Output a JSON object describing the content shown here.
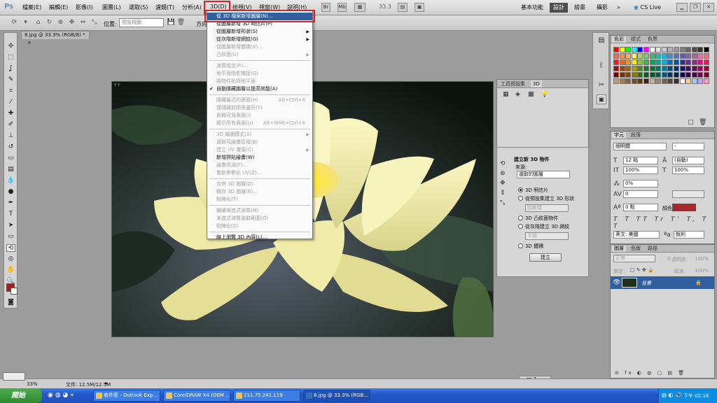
{
  "app": {
    "logo": "Ps",
    "menus": [
      "檔案(E)",
      "編輯(E)",
      "影像(I)",
      "圖層(L)",
      "選取(S)",
      "濾鏡(T)",
      "分析(A)",
      "3D(D)",
      "檢視(V)",
      "視窗(W)",
      "說明(H)"
    ],
    "zoom": "33.3",
    "workspaces": [
      "基本功能",
      "設計",
      "繪畫",
      "攝影"
    ],
    "cs_live": "CS Live"
  },
  "options": {
    "position_label": "位置:",
    "position_value": "預設視圖",
    "direction_label": "方向"
  },
  "document": {
    "tab_title": "8.jpg @ 33.3% (RGB/8) *",
    "status_zoom": "33%",
    "status_doc": "文件: 12.5M/12.5M"
  },
  "menu3d": {
    "items": [
      {
        "label": "從 3D 檔案新增圖層(N)...",
        "state": "highlight"
      },
      {
        "label": "從圖層新增 3D 明信片(P)",
        "state": "enabled"
      },
      {
        "label": "從圖層新增形狀(S)",
        "state": "enabled",
        "arrow": true
      },
      {
        "label": "從灰階新增網紋(G)",
        "state": "enabled",
        "arrow": true
      },
      {
        "label": "從圖層新增體積(V)...",
        "state": "disabled"
      },
      {
        "label": "凸紋面(U)",
        "state": "disabled",
        "arrow": true
      },
      {
        "sep": true
      },
      {
        "label": "演算設定(R)...",
        "state": "disabled"
      },
      {
        "label": "地平面陰影捕捉(G)",
        "state": "disabled"
      },
      {
        "label": "將物件貼齊地平面",
        "state": "disabled"
      },
      {
        "label": "自動隱藏圖層以提高效能(A)",
        "state": "enabled",
        "check": true
      },
      {
        "sep": true
      },
      {
        "label": "隱藏最近的表面(H)",
        "state": "disabled",
        "shortcut": "Alt+Ctrl+X"
      },
      {
        "label": "僅隱藏封閉多邊形(Y)",
        "state": "disabled"
      },
      {
        "label": "反轉可見表面(I)",
        "state": "disabled"
      },
      {
        "label": "顯示所有表面(U)",
        "state": "disabled",
        "shortcut": "Alt+Shift+Ctrl+X"
      },
      {
        "sep": true
      },
      {
        "label": "3D 繪圖模式(3)",
        "state": "disabled",
        "arrow": true
      },
      {
        "label": "選取可繪畫區域(B)",
        "state": "disabled"
      },
      {
        "label": "建立 UV 覆蓋(C)",
        "state": "disabled",
        "arrow": true
      },
      {
        "label": "新增拼貼繪畫(W)",
        "state": "enabled"
      },
      {
        "label": "繪畫衰減(F)...",
        "state": "disabled"
      },
      {
        "label": "重新參數化 UV(Z)...",
        "state": "disabled"
      },
      {
        "sep": true
      },
      {
        "label": "合併 3D 圖層(D)",
        "state": "disabled"
      },
      {
        "label": "轉存 3D 圖層(E)...",
        "state": "disabled"
      },
      {
        "label": "點陣化(T)",
        "state": "disabled"
      },
      {
        "sep": true
      },
      {
        "label": "繼續漸進式演算(M)",
        "state": "disabled"
      },
      {
        "label": "漸進式演算選取範圍(O)",
        "state": "disabled"
      },
      {
        "label": "點陣化(Z)",
        "state": "disabled"
      },
      {
        "sep": true
      },
      {
        "label": "線上瀏覽 3D 內容(L)...",
        "state": "enabled"
      }
    ]
  },
  "panel3d": {
    "tabs": [
      "工具預設集",
      "3D"
    ],
    "title": "建立新 3D 物件",
    "source_label": "來源:",
    "source_value": "選取的圖層",
    "opt_postcard": "3D 明信片",
    "opt_preset_shape": "從預設集建立 3D 形狀",
    "shape_select": "圓錐體",
    "opt_extrusion": "3D 凸紋面物件",
    "opt_grayscale_mesh": "從灰階建立 3D 網紋",
    "mesh_select": "平面",
    "opt_volume": "3D 體積",
    "create_button": "建立"
  },
  "swatches": {
    "tabs": [
      "色彩",
      "樣式",
      "色票"
    ],
    "colors": [
      "#ff0000",
      "#ffff00",
      "#00ff00",
      "#00ffff",
      "#0000ff",
      "#ff00ff",
      "#ffffff",
      "#e6e6e6",
      "#cccccc",
      "#b3b3b3",
      "#999999",
      "#808080",
      "#666666",
      "#4d4d4d",
      "#333333",
      "#000000",
      "#f26c4f",
      "#f68e55",
      "#fbaf5c",
      "#fff467",
      "#acd372",
      "#7cc576",
      "#3bb878",
      "#1abbb4",
      "#00bff3",
      "#438ccb",
      "#5574b9",
      "#605ca8",
      "#855fa8",
      "#a763a8",
      "#f06ea9",
      "#f26d7d",
      "#ed1c24",
      "#f26522",
      "#f7941d",
      "#fff200",
      "#8dc63f",
      "#39b54a",
      "#00a651",
      "#00a99d",
      "#00aeef",
      "#0072bc",
      "#0054a6",
      "#2e3192",
      "#662d91",
      "#92278f",
      "#ec008c",
      "#ed145b",
      "#9e0b0f",
      "#a0410d",
      "#a36209",
      "#aba000",
      "#598527",
      "#197b30",
      "#007236",
      "#00746b",
      "#0076a3",
      "#004b80",
      "#003471",
      "#1b1464",
      "#440e62",
      "#630460",
      "#9e005d",
      "#9e0039",
      "#790000",
      "#7b2e00",
      "#7d4900",
      "#827b00",
      "#406618",
      "#005e20",
      "#005826",
      "#005952",
      "#005b7f",
      "#003663",
      "#002157",
      "#0d004c",
      "#32004b",
      "#4b0049",
      "#7b0046",
      "#7a0026",
      "#c69c6d",
      "#a67c52",
      "#8c6239",
      "#754c24",
      "#603913",
      "#3c2415",
      "#c7b299",
      "#998675",
      "#736357",
      "#534741",
      "#37302d",
      "#ffffff",
      "#ffcc99",
      "#99ccff",
      "#cc99ff",
      "#ff99cc"
    ]
  },
  "character": {
    "tabs": [
      "字元",
      "段落"
    ],
    "font": "細明體",
    "style": "-",
    "size": "12 點",
    "leading": "(自動)",
    "vscale": "100%",
    "hscale": "100%",
    "tracking_ratio": "0%",
    "tracking": "0",
    "baseline": "0 點",
    "color_label": "顏色:",
    "color_value": "#a22a2a",
    "language": "英文: 美國",
    "aa": "銳利"
  },
  "layers": {
    "tabs": [
      "圖層",
      "色版",
      "路徑"
    ],
    "blend": "正常",
    "opacity_label": "不透明度:",
    "opacity": "100%",
    "lock_label": "鎖定:",
    "fill_label": "填滿:",
    "fill": "100%",
    "layer_name": "背景"
  },
  "taskbar": {
    "start": "開始",
    "tasks": [
      "收件匣 - Outlook Exp...",
      "CorelDRAW X4 (OEM ...",
      "211.75.241.119",
      "8.jpg @ 33.3% (RGB..."
    ],
    "clock": "下午 02:16"
  }
}
